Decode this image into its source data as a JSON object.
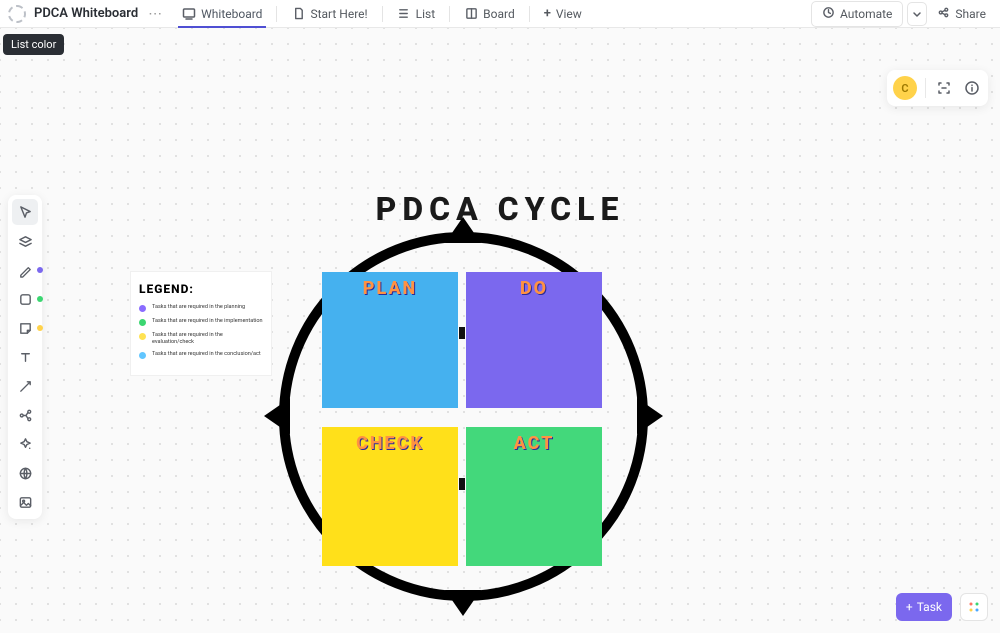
{
  "header": {
    "title": "PDCA Whiteboard",
    "tabs": [
      {
        "label": "Whiteboard"
      },
      {
        "label": "Start Here!"
      },
      {
        "label": "List"
      },
      {
        "label": "Board"
      },
      {
        "label": "View"
      }
    ],
    "automate": "Automate",
    "share": "Share"
  },
  "tooltip": "List color",
  "avatar": "C",
  "task_button": "Task",
  "canvas": {
    "title": "PDCA CYCLE",
    "squares": {
      "plan": "PLAN",
      "do": "DO",
      "check": "CHECK",
      "act": "ACT"
    },
    "legend": {
      "heading": "LEGEND:",
      "items": [
        {
          "color": "#8a6cff",
          "text": "Tasks that are required in the planning"
        },
        {
          "color": "#3bd671",
          "text": "Tasks that are required in the implementation"
        },
        {
          "color": "#ffe252",
          "text": "Tasks that are required in the evaluation/check"
        },
        {
          "color": "#62c6ff",
          "text": "Tasks that are required in the conclusion/act"
        }
      ]
    }
  }
}
